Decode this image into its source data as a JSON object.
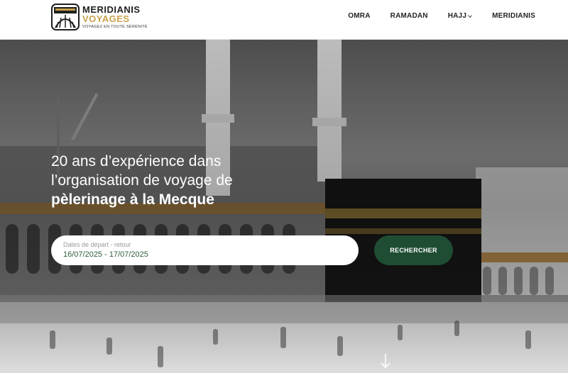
{
  "header": {
    "logo": {
      "line1": "MERIDIANIS",
      "line2": "VOYAGES",
      "tagline": "VOYAGEZ EN TOUTE SÉRÉNITÉ"
    },
    "nav": [
      {
        "label": "OMRA"
      },
      {
        "label": "RAMADAN"
      },
      {
        "label": "HAJJ",
        "has_dropdown": true
      },
      {
        "label": "MERIDIANIS"
      }
    ]
  },
  "hero": {
    "headline_line1": "20 ans d’expérience dans",
    "headline_line2": "l’organisation de voyage de",
    "headline_line3": "pèlerinage à la Mecque",
    "search": {
      "label": "Dates de départ - retour",
      "value": "16/07/2025 - 17/07/2025"
    },
    "search_button": "RECHERCHER"
  },
  "colors": {
    "brand_green": "#1f4d34",
    "brand_gold": "#c9a24a",
    "date_text": "#2f5d3a"
  }
}
